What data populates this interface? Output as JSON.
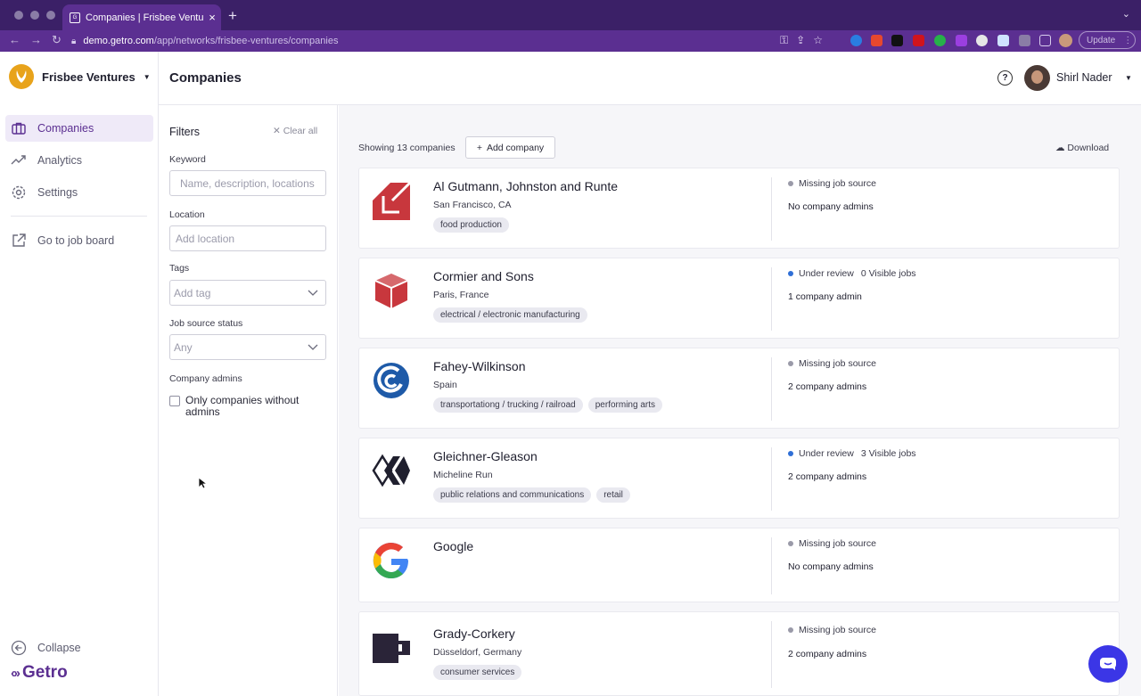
{
  "browser": {
    "tab_title": "Companies | Frisbee Ventures",
    "url_host": "demo.getro.com",
    "url_path": "/app/networks/frisbee-ventures/companies",
    "update_label": "Update"
  },
  "sidebar": {
    "brand": "Frisbee Ventures",
    "items": [
      {
        "label": "Companies",
        "icon": "briefcase-icon",
        "active": true
      },
      {
        "label": "Analytics",
        "icon": "trend-icon",
        "active": false
      },
      {
        "label": "Settings",
        "icon": "gear-icon",
        "active": false
      }
    ],
    "job_board": "Go to job board",
    "collapse": "Collapse",
    "footer_logo": "Getro"
  },
  "header": {
    "title": "Companies",
    "user_name": "Shirl Nader"
  },
  "filters": {
    "title": "Filters",
    "clear_all": "Clear all",
    "keyword_label": "Keyword",
    "keyword_placeholder": "Name, description, locations",
    "location_label": "Location",
    "location_placeholder": "Add location",
    "tags_label": "Tags",
    "tags_placeholder": "Add tag",
    "job_source_label": "Job source status",
    "job_source_value": "Any",
    "admins_label": "Company admins",
    "admins_checkbox": "Only companies without admins"
  },
  "list": {
    "count_text": "Showing 13 companies",
    "add_company": "Add company",
    "download": "Download",
    "companies": [
      {
        "name": "Al Gutmann, Johnston and Runte",
        "location": "San Francisco, CA",
        "tags": [
          "food production"
        ],
        "status": "Missing job source",
        "status_color": "#9a9aa8",
        "jobs": "",
        "admins": "No company admins"
      },
      {
        "name": "Cormier and Sons",
        "location": "Paris, France",
        "tags": [
          "electrical / electronic manufacturing"
        ],
        "status": "Under review",
        "status_color": "#2f6fd6",
        "jobs": "0 Visible jobs",
        "admins": "1 company admin"
      },
      {
        "name": "Fahey-Wilkinson",
        "location": "Spain",
        "tags": [
          "transportationg / trucking / railroad",
          "performing arts"
        ],
        "status": "Missing job source",
        "status_color": "#9a9aa8",
        "jobs": "",
        "admins": "2 company admins"
      },
      {
        "name": "Gleichner-Gleason",
        "location": "Micheline Run",
        "tags": [
          "public relations and communications",
          "retail"
        ],
        "status": "Under review",
        "status_color": "#2f6fd6",
        "jobs": "3 Visible jobs",
        "admins": "2 company admins"
      },
      {
        "name": "Google",
        "location": "",
        "tags": [],
        "status": "Missing job source",
        "status_color": "#9a9aa8",
        "jobs": "",
        "admins": "No company admins"
      },
      {
        "name": "Grady-Corkery",
        "location": "Düsseldorf, Germany",
        "tags": [
          "consumer services"
        ],
        "status": "Missing job source",
        "status_color": "#9a9aa8",
        "jobs": "",
        "admins": "2 company admins"
      }
    ]
  },
  "colors": {
    "brand_purple": "#5b2f91",
    "chrome": "#3b2067",
    "chat_button": "#3b36e6"
  }
}
